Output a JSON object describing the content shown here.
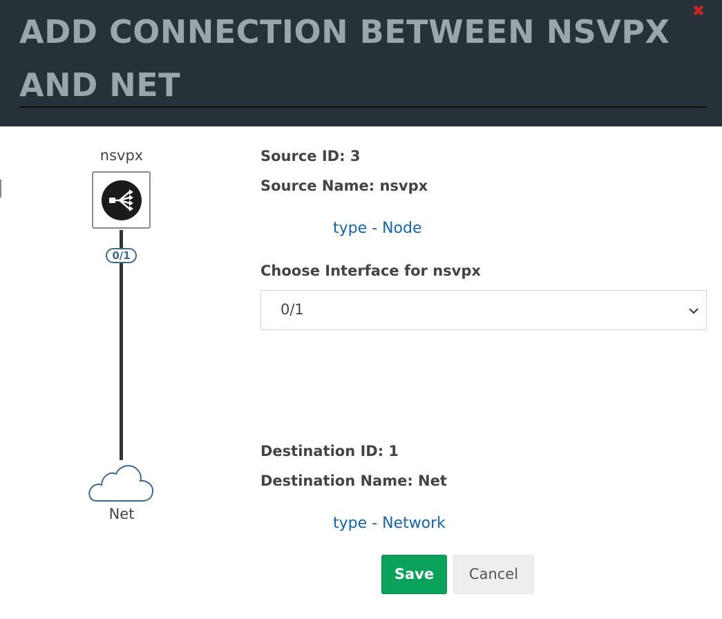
{
  "dialog": {
    "title": "ADD CONNECTION BETWEEN NSVPX AND NET",
    "close_icon": "close-x-icon",
    "colors": {
      "header_bg": "#263238",
      "title": "#9aa6ab",
      "close": "#c62828",
      "link": "#1565a8",
      "save_bg": "#0aa25a"
    }
  },
  "diagram": {
    "source_node": {
      "label": "nsvpx",
      "icon": "network-distribution-icon"
    },
    "interface_badge": "0/1",
    "destination_node": {
      "label": "Net",
      "icon": "cloud-icon"
    }
  },
  "source": {
    "id_text": "Source ID: 3",
    "name_text": "Source Name: nsvpx",
    "type_link": "type - Node"
  },
  "interface": {
    "label": "Choose Interface for nsvpx",
    "selected": "0/1"
  },
  "destination": {
    "id_text": "Destination ID: 1",
    "name_text": "Destination Name: Net",
    "type_link": "type - Network"
  },
  "buttons": {
    "save": "Save",
    "cancel": "Cancel"
  }
}
